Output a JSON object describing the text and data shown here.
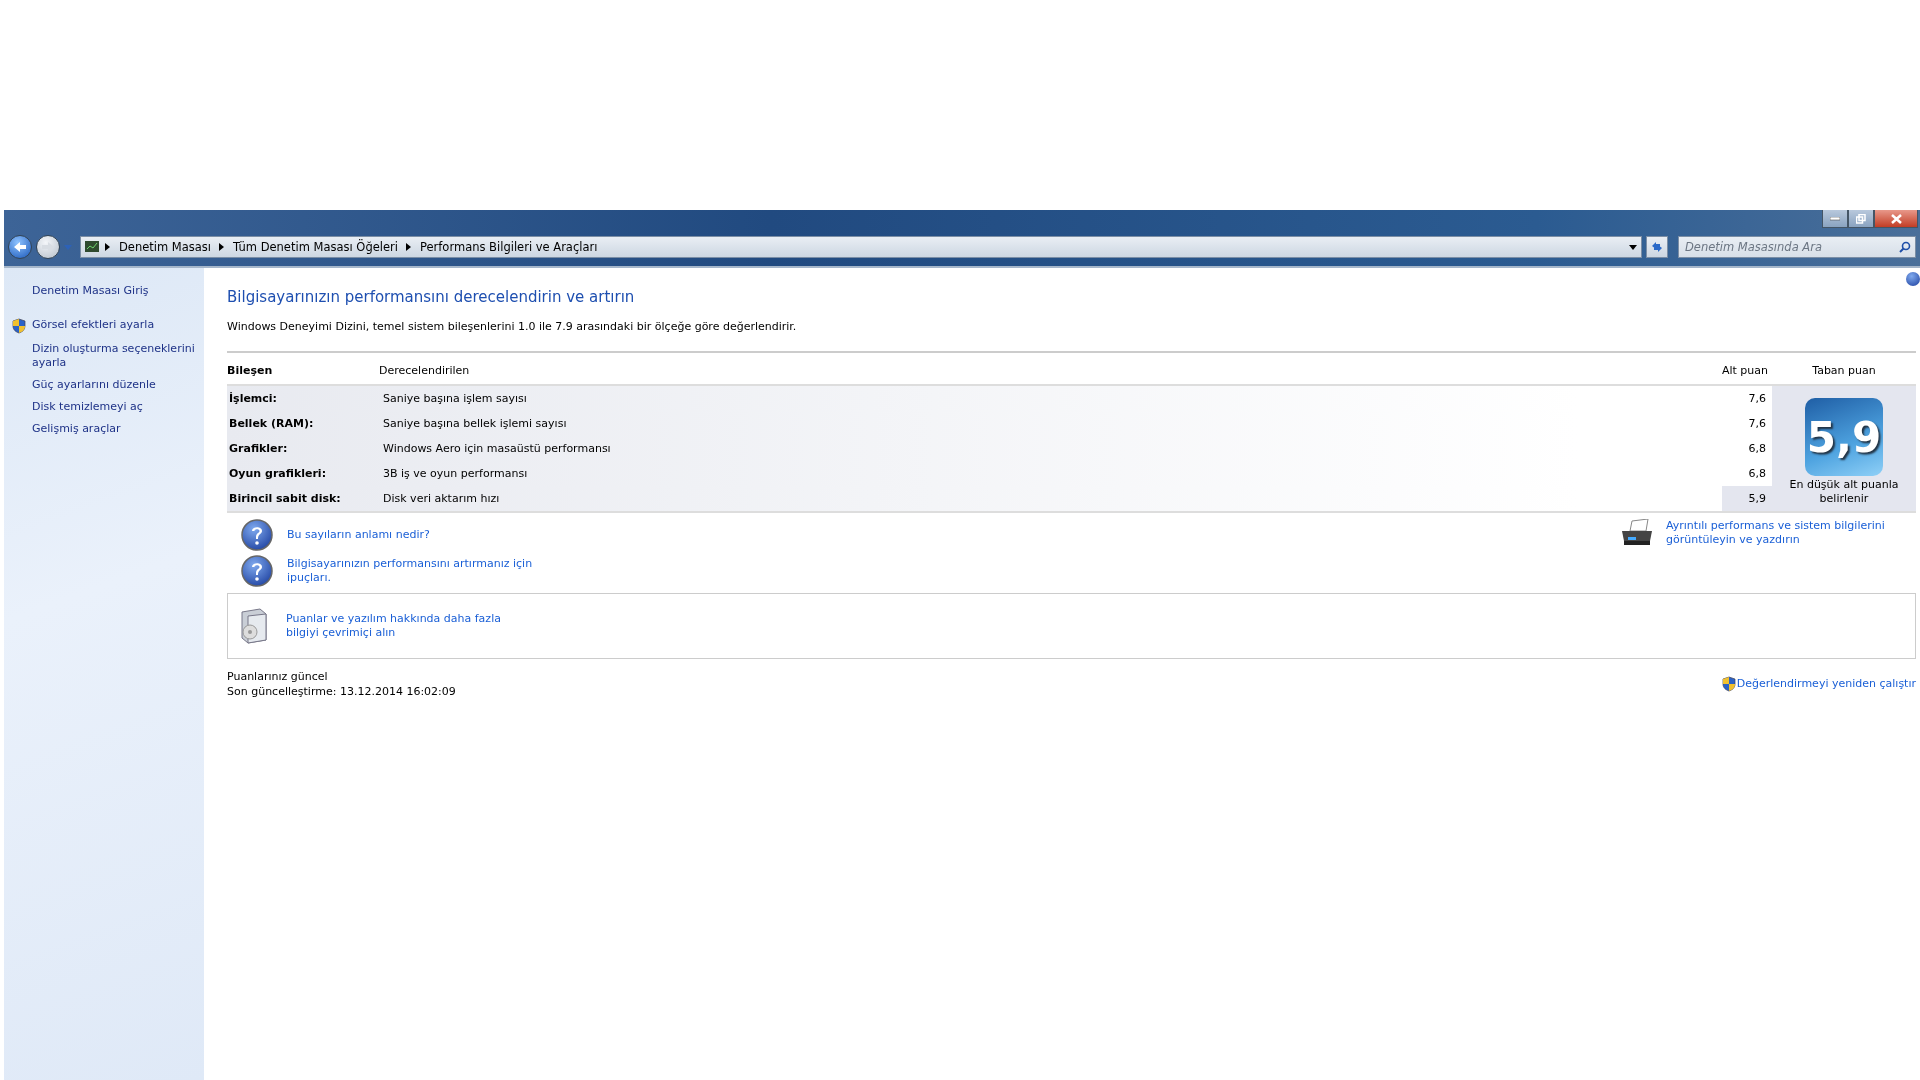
{
  "address_bar": {
    "breadcrumbs": [
      "Denetim Masası",
      "Tüm Denetim Masası Öğeleri",
      "Performans Bilgileri ve Araçları"
    ],
    "search": {
      "placeholder": "Denetim Masasında Ara"
    }
  },
  "sidebar": {
    "items": [
      {
        "label": "Denetim Masası Giriş",
        "kind": "home"
      },
      {
        "label": "Görsel efektleri ayarla",
        "kind": "shield"
      },
      {
        "label": "Dizin oluşturma seçeneklerini ayarla",
        "kind": "plain"
      },
      {
        "label": "Güç ayarlarını düzenle",
        "kind": "plain"
      },
      {
        "label": "Disk temizlemeyi aç",
        "kind": "plain"
      },
      {
        "label": "Gelişmiş araçlar",
        "kind": "plain"
      }
    ]
  },
  "content": {
    "title": "Bilgisayarınızın performansını derecelendirin ve artırın",
    "description": "Windows Deneyimi Dizini, temel sistem bileşenlerini 1.0 ile 7.9 arasındaki bir ölçeğe göre değerlendirir.",
    "table": {
      "columns": [
        "Bileşen",
        "Derecelendirilen",
        "Alt puan",
        "Taban puan"
      ],
      "rows": [
        {
          "component": "İşlemci:",
          "rated": "Saniye başına işlem sayısı",
          "subscore": "7,6",
          "lowest": false
        },
        {
          "component": "Bellek (RAM):",
          "rated": "Saniye başına bellek işlemi sayısı",
          "subscore": "7,6",
          "lowest": false
        },
        {
          "component": "Grafikler:",
          "rated": "Windows Aero için masaüstü performansı",
          "subscore": "6,8",
          "lowest": false
        },
        {
          "component": "Oyun grafikleri:",
          "rated": "3B iş ve oyun performansı",
          "subscore": "6,8",
          "lowest": false
        },
        {
          "component": "Birincil sabit disk:",
          "rated": "Disk veri aktarım hızı",
          "subscore": "5,9",
          "lowest": true
        }
      ],
      "base_score": "5,9",
      "base_caption": "En düşük alt puanla belirlenir"
    },
    "help_links": [
      "Bu sayıların anlamı nedir?",
      "Bilgisayarınızın performansını artırmanız için ipuçları."
    ],
    "print_link": "Ayrıntılı performans ve sistem bilgilerini görüntüleyin ve yazdırın",
    "online_link": "Puanlar ve yazılım hakkında daha fazla bilgiyi çevrimiçi alın",
    "status": [
      "Puanlarınız güncel",
      "Son güncelleştirme: 13.12.2014 16:02:09"
    ],
    "rerun_link": "Değerlendirmeyi yeniden çalıştır"
  }
}
